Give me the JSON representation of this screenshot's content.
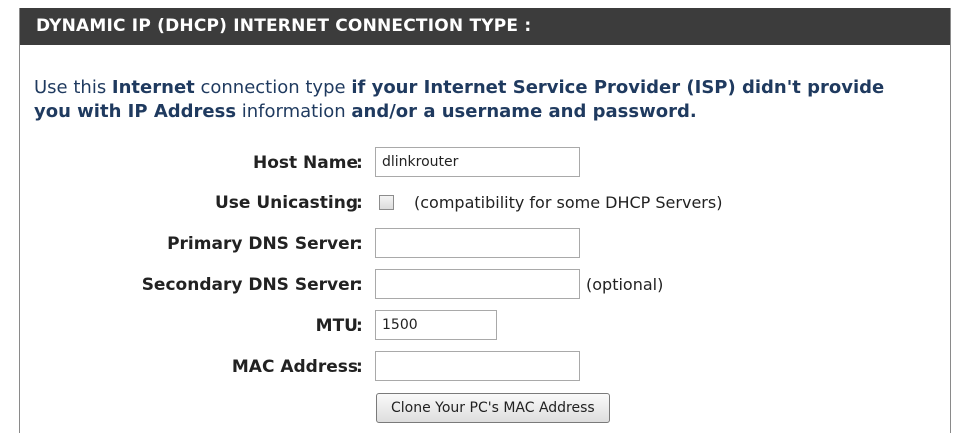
{
  "section": {
    "title": "DYNAMIC IP (DHCP) INTERNET CONNECTION TYPE :"
  },
  "intro": {
    "part1": "Use this ",
    "part2": "Internet",
    "part3": " connection type ",
    "part4": "if your Internet Service Provider (ISP) didn't provide",
    "part5": "you with ",
    "part6": "IP Address",
    "part7": " information ",
    "part8": "and/or a username and password."
  },
  "fields": {
    "host_name": {
      "label": "Host Name",
      "value": "dlinkrouter"
    },
    "use_unicasting": {
      "label": "Use Unicasting",
      "note": "(compatibility for some DHCP Servers)",
      "checked": false
    },
    "primary_dns": {
      "label": "Primary DNS Server",
      "value": ""
    },
    "secondary_dns": {
      "label": "Secondary DNS Server",
      "value": "",
      "note": "(optional)"
    },
    "mtu": {
      "label": "MTU",
      "value": "1500"
    },
    "mac_address": {
      "label": "MAC Address",
      "value": ""
    }
  },
  "colon": ":",
  "clone_button": {
    "label": "Clone Your PC's MAC Address"
  }
}
